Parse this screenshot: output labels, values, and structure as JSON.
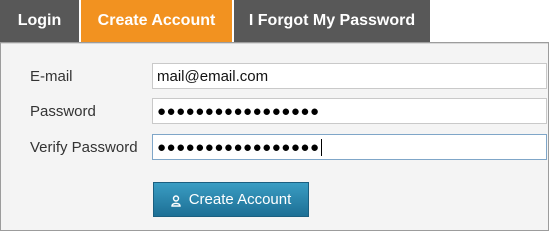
{
  "tabs": {
    "login": "Login",
    "create_account": "Create Account",
    "forgot_password": "I Forgot My Password"
  },
  "form": {
    "email_label": "E-mail",
    "email_value": "mail@email.com",
    "password_label": "Password",
    "password_masked": "●●●●●●●●●●●●●●●●●",
    "verify_label": "Verify Password",
    "verify_masked": "●●●●●●●●●●●●●●●●●",
    "submit_label": "Create Account",
    "submit_icon": "user-icon"
  },
  "colors": {
    "tab_active": "#f29220",
    "tab_inactive": "#585858",
    "button": "#2a86ad"
  }
}
